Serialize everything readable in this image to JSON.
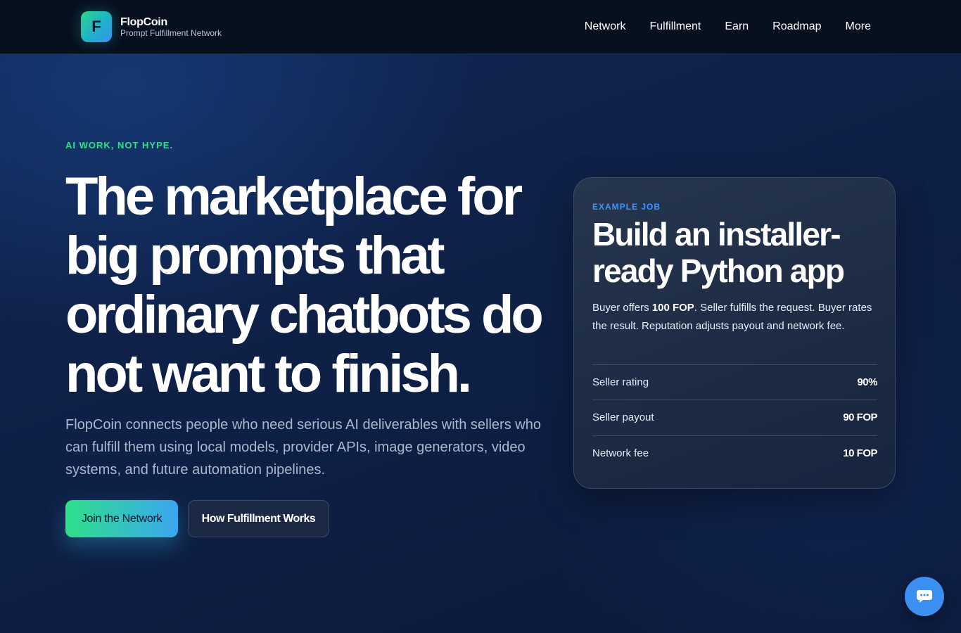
{
  "header": {
    "logo_letter": "F",
    "brand_name": "FlopCoin",
    "brand_tagline": "Prompt Fulfillment Network",
    "nav": [
      {
        "label": "Network"
      },
      {
        "label": "Fulfillment"
      },
      {
        "label": "Earn"
      },
      {
        "label": "Roadmap"
      },
      {
        "label": "More"
      }
    ]
  },
  "hero": {
    "eyebrow": "AI WORK, NOT HYPE.",
    "headline": "The marketplace for big prompts that ordinary chatbots do not want to finish.",
    "lede": "FlopCoin connects people who need serious AI deliverables with sellers who can fulfill them using local models, provider APIs, image generators, video systems, and future automation pipelines.",
    "primary_cta": "Join the Network",
    "secondary_cta": "How Fulfillment Works"
  },
  "example_job": {
    "eyebrow": "EXAMPLE JOB",
    "title": "Build an installer-ready Python app",
    "desc_prefix": "Buyer offers ",
    "desc_amount": "100 FOP",
    "desc_suffix": ". Seller fulfills the request. Buyer rates the result. Reputation adjusts payout and network fee.",
    "stats": [
      {
        "label": "Seller rating",
        "value": "90%"
      },
      {
        "label": "Seller payout",
        "value": "90 FOP"
      },
      {
        "label": "Network fee",
        "value": "10 FOP"
      }
    ]
  },
  "chat": {
    "icon": "chat-bubble-icon"
  },
  "colors": {
    "accent_green": "#2ee088",
    "accent_blue": "#3b8ff0",
    "header_bg": "#06101f"
  }
}
